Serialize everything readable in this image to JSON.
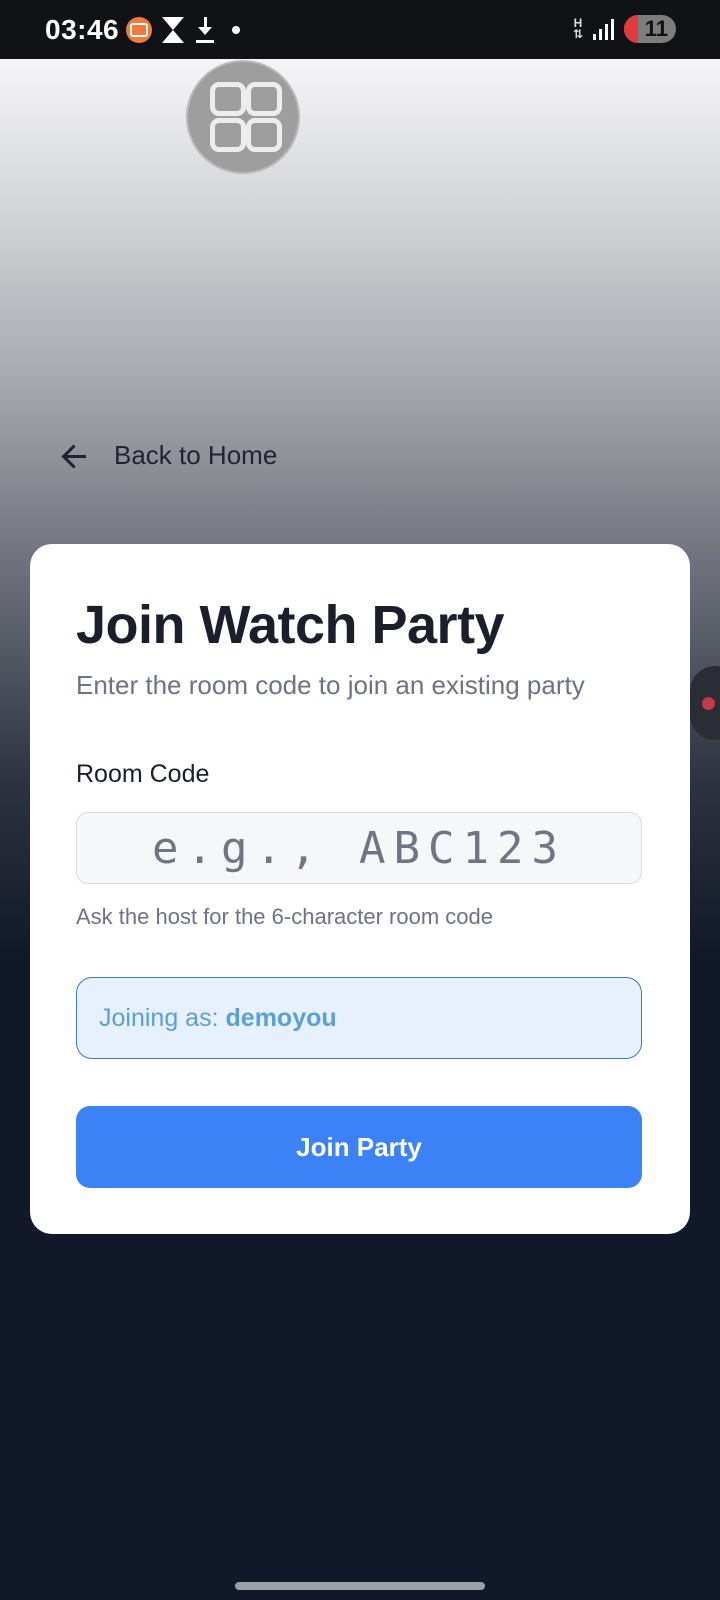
{
  "status_bar": {
    "time": "03:46",
    "network_label": "H",
    "battery_level": "11",
    "icons": [
      "screen-recorder-icon",
      "hourglass-icon",
      "download-icon",
      "dot-icon",
      "network-icon",
      "signal-icon",
      "battery-icon"
    ]
  },
  "floating_widget": {
    "icon": "app-grid-icon"
  },
  "nav": {
    "back_label": "Back to Home",
    "back_icon": "arrow-left-icon"
  },
  "card": {
    "title": "Join Watch Party",
    "subtitle": "Enter the room code to join an existing party",
    "room_code_label": "Room Code",
    "room_code_placeholder": "e.g., ABC123",
    "room_code_value": "",
    "hint": "Ask the host for the 6-character room code",
    "joining_as_label": "Joining as:",
    "username": "demoyou",
    "join_button_label": "Join Party"
  },
  "colors": {
    "accent": "#3b82f6",
    "page_dark": "#111827",
    "info_bg": "#e7f1fe",
    "info_text": "#5aa0d8"
  }
}
